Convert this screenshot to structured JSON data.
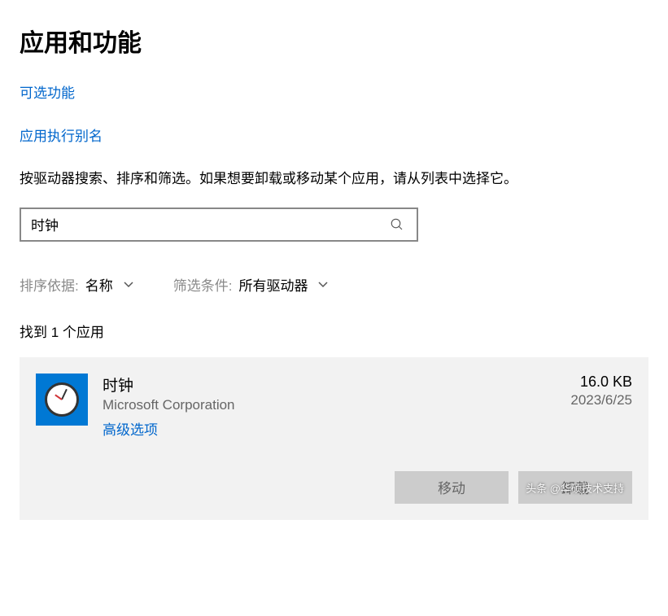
{
  "header": {
    "title": "应用和功能"
  },
  "links": {
    "optional_features": "可选功能",
    "app_aliases": "应用执行别名"
  },
  "description": "按驱动器搜索、排序和筛选。如果想要卸载或移动某个应用，请从列表中选择它。",
  "search": {
    "value": "时钟"
  },
  "sort": {
    "label": "排序依据:",
    "value": "名称"
  },
  "filter": {
    "label": "筛选条件:",
    "value": "所有驱动器"
  },
  "results": {
    "count_text": "找到 1 个应用"
  },
  "app": {
    "name": "时钟",
    "publisher": "Microsoft Corporation",
    "advanced_link": "高级选项",
    "size": "16.0 KB",
    "date": "2023/6/25"
  },
  "buttons": {
    "move": "移动",
    "uninstall": "卸载"
  },
  "watermark": "头条 @华硕技术支持"
}
